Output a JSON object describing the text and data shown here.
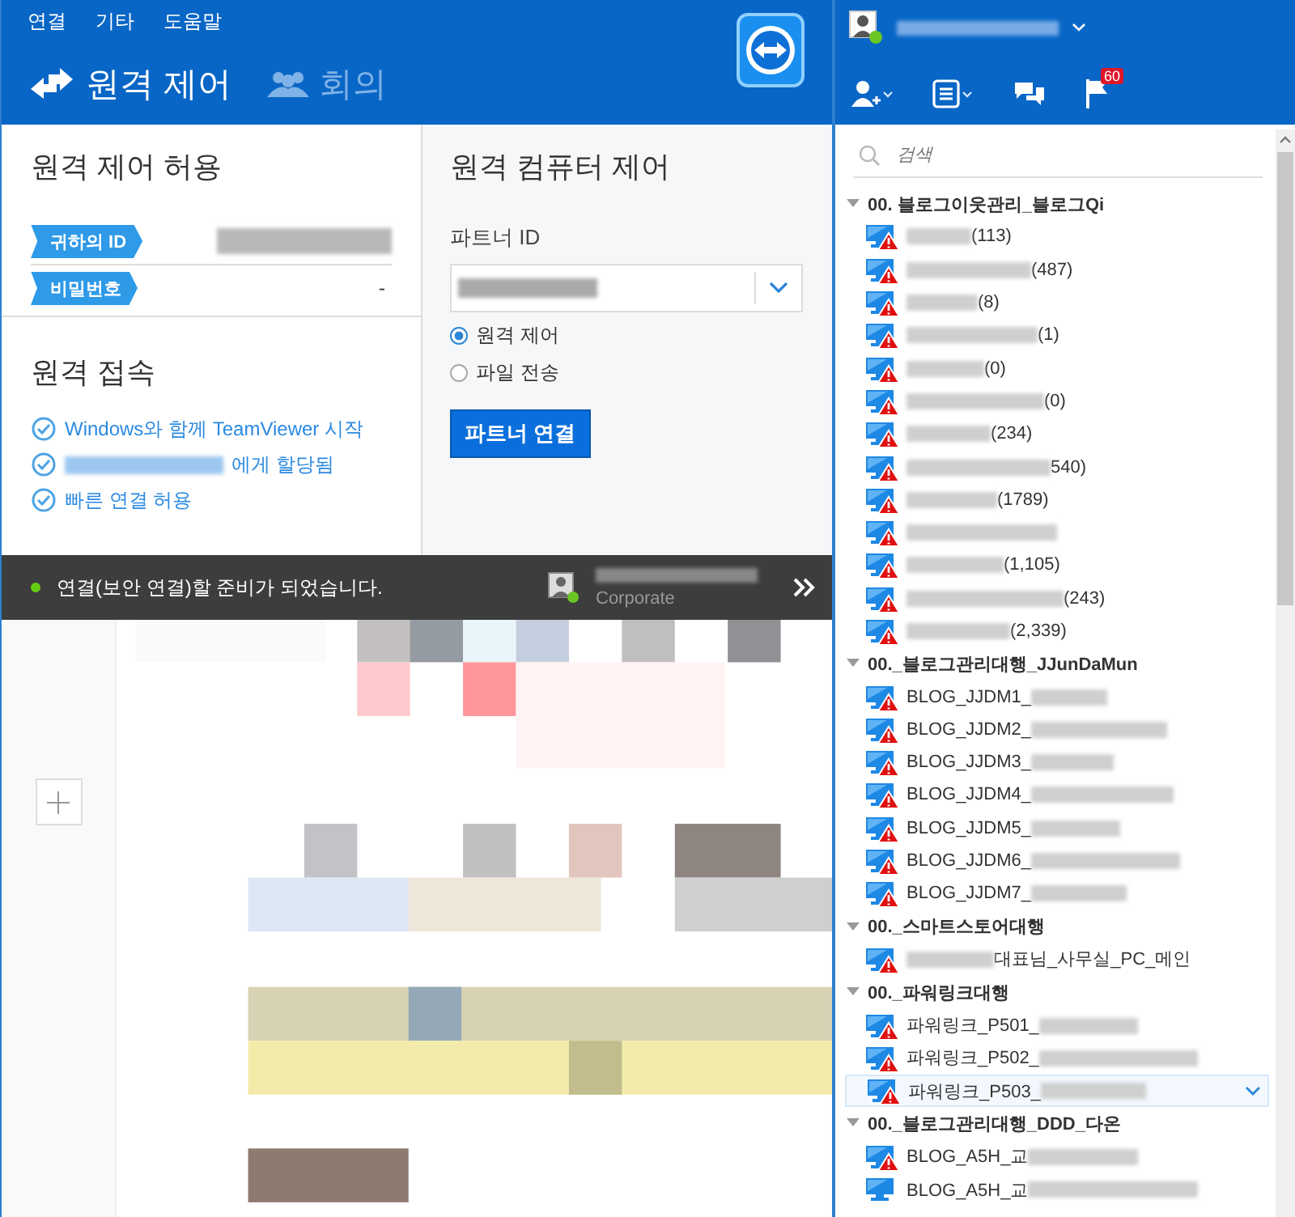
{
  "menu": [
    "연결",
    "기타",
    "도움말"
  ],
  "tabs": [
    {
      "label": "원격 제어",
      "selected": true,
      "kind": "remote"
    },
    {
      "label": "회의",
      "selected": false,
      "kind": "meeting"
    }
  ],
  "allow_remote": {
    "title": "원격 제어 허용",
    "fields": [
      {
        "label": "귀하의 ID",
        "redacted": true
      },
      {
        "label": "비밀번호",
        "redacted": false,
        "value": "-"
      }
    ]
  },
  "unattended": {
    "title": "원격 접속",
    "items": [
      {
        "text": "Windows와 함께 TeamViewer 시작",
        "redacted": false,
        "checked": true
      },
      {
        "text": "에게 할당됨",
        "redacted": true,
        "checked": true
      },
      {
        "text": "빠른 연결 허용",
        "redacted": false,
        "checked": true
      }
    ]
  },
  "control": {
    "title": "원격 컴퓨터 제어",
    "partner_label": "파트너 ID",
    "value_redacted": true,
    "modes": [
      {
        "label": "원격 제어",
        "selected": true
      },
      {
        "label": "파일 전송",
        "selected": false
      }
    ],
    "button": "파트너 연결"
  },
  "status_bar": {
    "ready": true,
    "message": "연결(보안 연결)할 준비가 되었습니다.",
    "account_type": "Corporate",
    "online": true
  },
  "contacts": {
    "online": true,
    "unread": "60",
    "search": {
      "placeholder": "검색"
    },
    "groups": [
      {
        "name": "00. 블로그이웃관리_블로그Qi",
        "expanded": true,
        "items": [
          {
            "suffix": "(113)",
            "warning": true,
            "selected": false
          },
          {
            "suffix": "(487)",
            "warning": true,
            "selected": false
          },
          {
            "suffix": "(8)",
            "warning": true,
            "selected": false
          },
          {
            "suffix": "(1)",
            "warning": true,
            "selected": false
          },
          {
            "suffix": "(0)",
            "warning": true,
            "selected": false
          },
          {
            "suffix": "(0)",
            "warning": true,
            "selected": false
          },
          {
            "suffix": "(234)",
            "warning": true,
            "selected": false
          },
          {
            "suffix": "540)",
            "warning": true,
            "selected": false
          },
          {
            "suffix": "(1789)",
            "warning": true,
            "selected": false
          },
          {
            "warning": true,
            "selected": false
          },
          {
            "suffix": "(1,105)",
            "warning": true,
            "selected": false
          },
          {
            "suffix": "(243)",
            "warning": true,
            "selected": false
          },
          {
            "suffix": "(2,339)",
            "warning": true,
            "selected": false
          }
        ]
      },
      {
        "name": "00._블로그관리대행_JJunDaMun",
        "expanded": true,
        "items": [
          {
            "prefix": "BLOG_JJDM1_",
            "warning": true,
            "selected": false
          },
          {
            "prefix": "BLOG_JJDM2_",
            "warning": true,
            "selected": false
          },
          {
            "prefix": "BLOG_JJDM3_",
            "warning": true,
            "selected": false
          },
          {
            "prefix": "BLOG_JJDM4_",
            "warning": true,
            "selected": false
          },
          {
            "prefix": "BLOG_JJDM5_",
            "warning": true,
            "selected": false
          },
          {
            "prefix": "BLOG_JJDM6_",
            "warning": true,
            "selected": false
          },
          {
            "prefix": "BLOG_JJDM7_",
            "warning": true,
            "selected": false
          }
        ]
      },
      {
        "name": "00._스마트스토어대행",
        "expanded": true,
        "items": [
          {
            "suffix": "대표님_사무실_PC_메인",
            "warning": true,
            "selected": false
          }
        ]
      },
      {
        "name": "00._파워링크대행",
        "expanded": true,
        "items": [
          {
            "prefix": "파워링크_P501_",
            "warning": true,
            "selected": false
          },
          {
            "prefix": "파워링크_P502_",
            "warning": true,
            "selected": false
          },
          {
            "prefix": "파워링크_P503_",
            "warning": true,
            "selected": true
          }
        ]
      },
      {
        "name": "00._블로그관리대행_DDD_다온",
        "expanded": true,
        "items": [
          {
            "prefix": "BLOG_A5H_교",
            "warning": true,
            "selected": false
          },
          {
            "prefix": "BLOG_A5H_교",
            "warning": false,
            "selected": false
          }
        ]
      }
    ]
  }
}
